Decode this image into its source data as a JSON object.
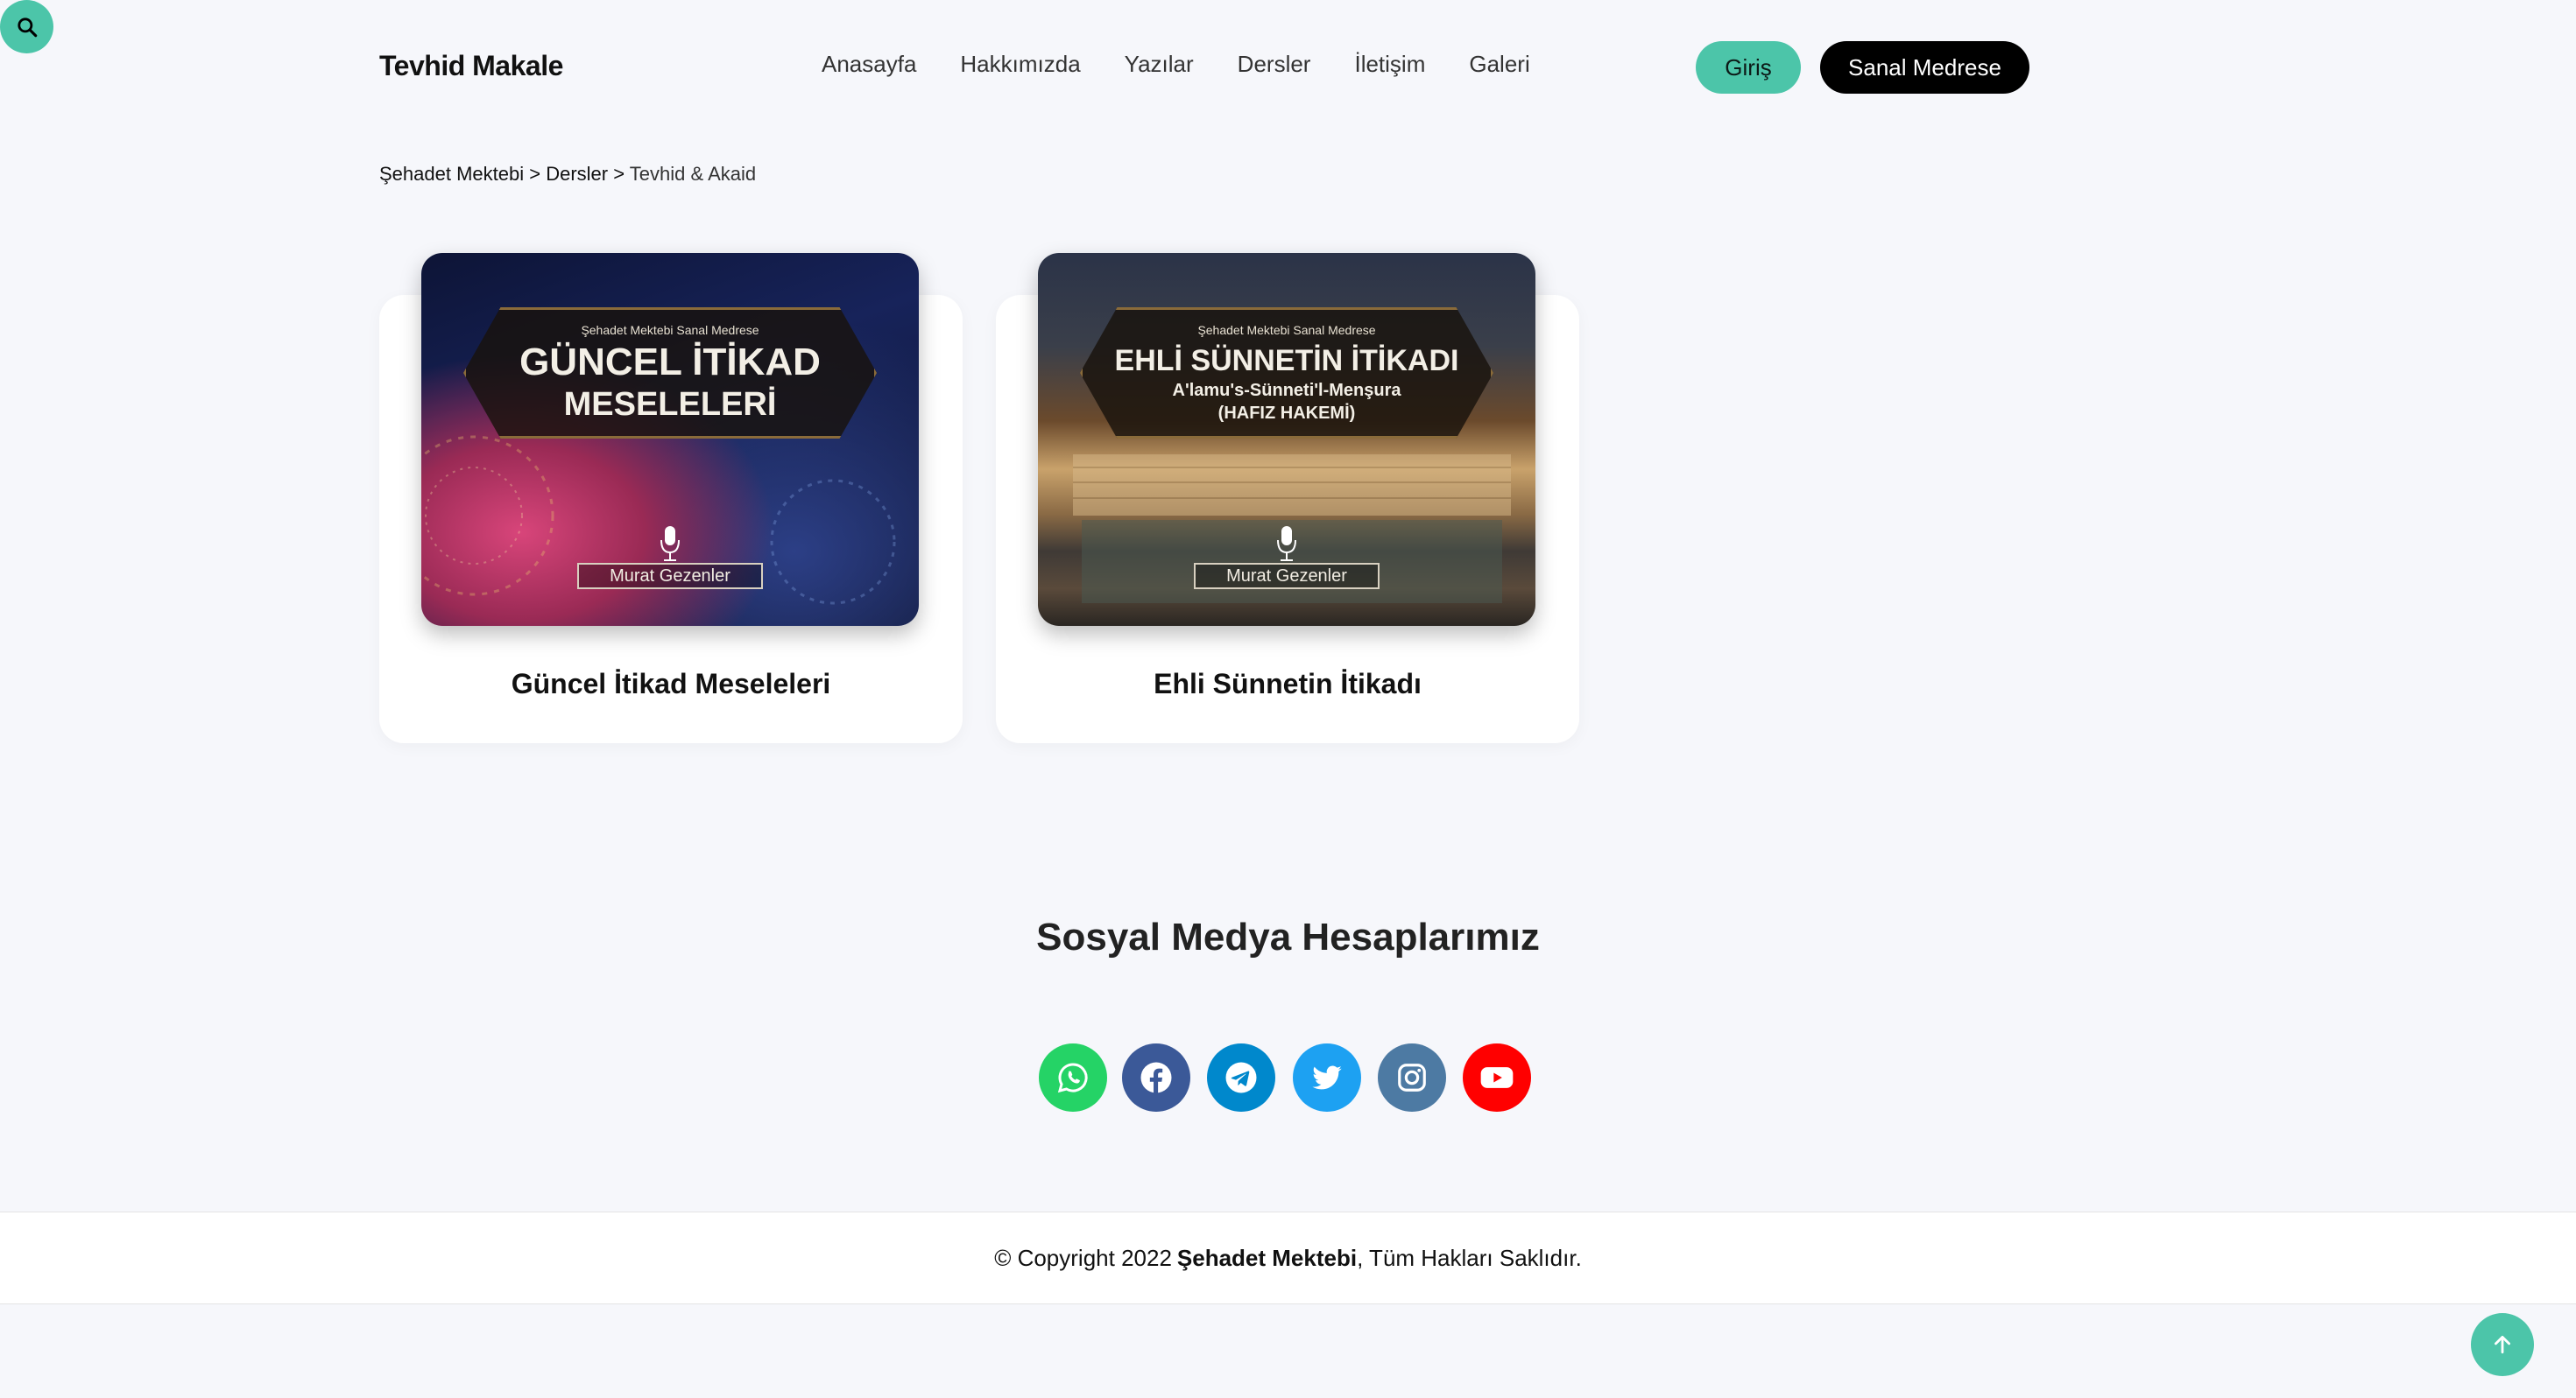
{
  "brand": {
    "name": "Tevhid Makale"
  },
  "nav": {
    "items": [
      "Anasayfa",
      "Hakkımızda",
      "Yazılar",
      "Dersler",
      "İletişim",
      "Galeri"
    ]
  },
  "header_actions": {
    "login_label": "Giriş",
    "medrese_label": "Sanal Medrese",
    "search_icon": "search-icon"
  },
  "breadcrumb": {
    "items": [
      "Şehadet Mektebi",
      "Dersler",
      "Tevhid & Akaid"
    ],
    "separator": ">"
  },
  "courses": [
    {
      "title": "Güncel İtikad Meseleleri",
      "image": {
        "overline": "Şehadet Mektebi Sanal Medrese",
        "headline_1": "GÜNCEL İTİKAD",
        "headline_2": "MESELELERİ",
        "author": "Murat Gezenler"
      }
    },
    {
      "title": "Ehli Sünnetin İtikadı",
      "image": {
        "overline": "Şehadet Mektebi Sanal Medrese",
        "headline_1": "EHLİ SÜNNETİN İTİKADI",
        "headline_2": "A'lamu's-Sünneti'l-Menşura",
        "headline_3": "(HAFIZ HAKEMİ)",
        "author": "Murat Gezenler"
      }
    }
  ],
  "social": {
    "title": "Sosyal Medya Hesaplarımız",
    "accounts": [
      {
        "icon": "whatsapp-icon",
        "color": "#25d366"
      },
      {
        "icon": "facebook-icon",
        "color": "#3b5998"
      },
      {
        "icon": "telegram-icon",
        "color": "#0088cc"
      },
      {
        "icon": "twitter-icon",
        "color": "#1da1f2"
      },
      {
        "icon": "instagram-icon",
        "color": "#4d7aa3"
      },
      {
        "icon": "youtube-icon",
        "color": "#ff0000"
      }
    ]
  },
  "footer": {
    "copyright_prefix": "© Copyright 2022",
    "owner": "Şehadet Mektebi",
    "suffix": ", Tüm Hakları Saklıdır."
  },
  "colors": {
    "accent": "#4cc5a9",
    "dark": "#000000",
    "background": "#f6f7fb"
  }
}
